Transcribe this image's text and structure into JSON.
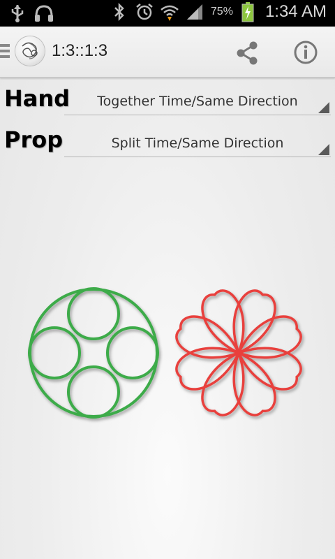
{
  "status_bar": {
    "battery_percent": "75%",
    "time": "1:34 AM",
    "icons": [
      "usb-icon",
      "headphones-icon",
      "bluetooth-icon",
      "alarm-icon",
      "wifi-icon",
      "signal-icon",
      "battery-charging-icon"
    ]
  },
  "action_bar": {
    "title": "1:3::1:3",
    "icons": [
      "menu-icon",
      "app-logo-icon",
      "share-icon",
      "info-icon"
    ]
  },
  "hand": {
    "label": "Hand",
    "selected": "Together Time/Same Direction"
  },
  "prop": {
    "label": "Prop",
    "selected": "Split Time/Same Direction"
  },
  "colors": {
    "hand_pattern": "#3cab4a",
    "prop_pattern": "#e8403c"
  }
}
